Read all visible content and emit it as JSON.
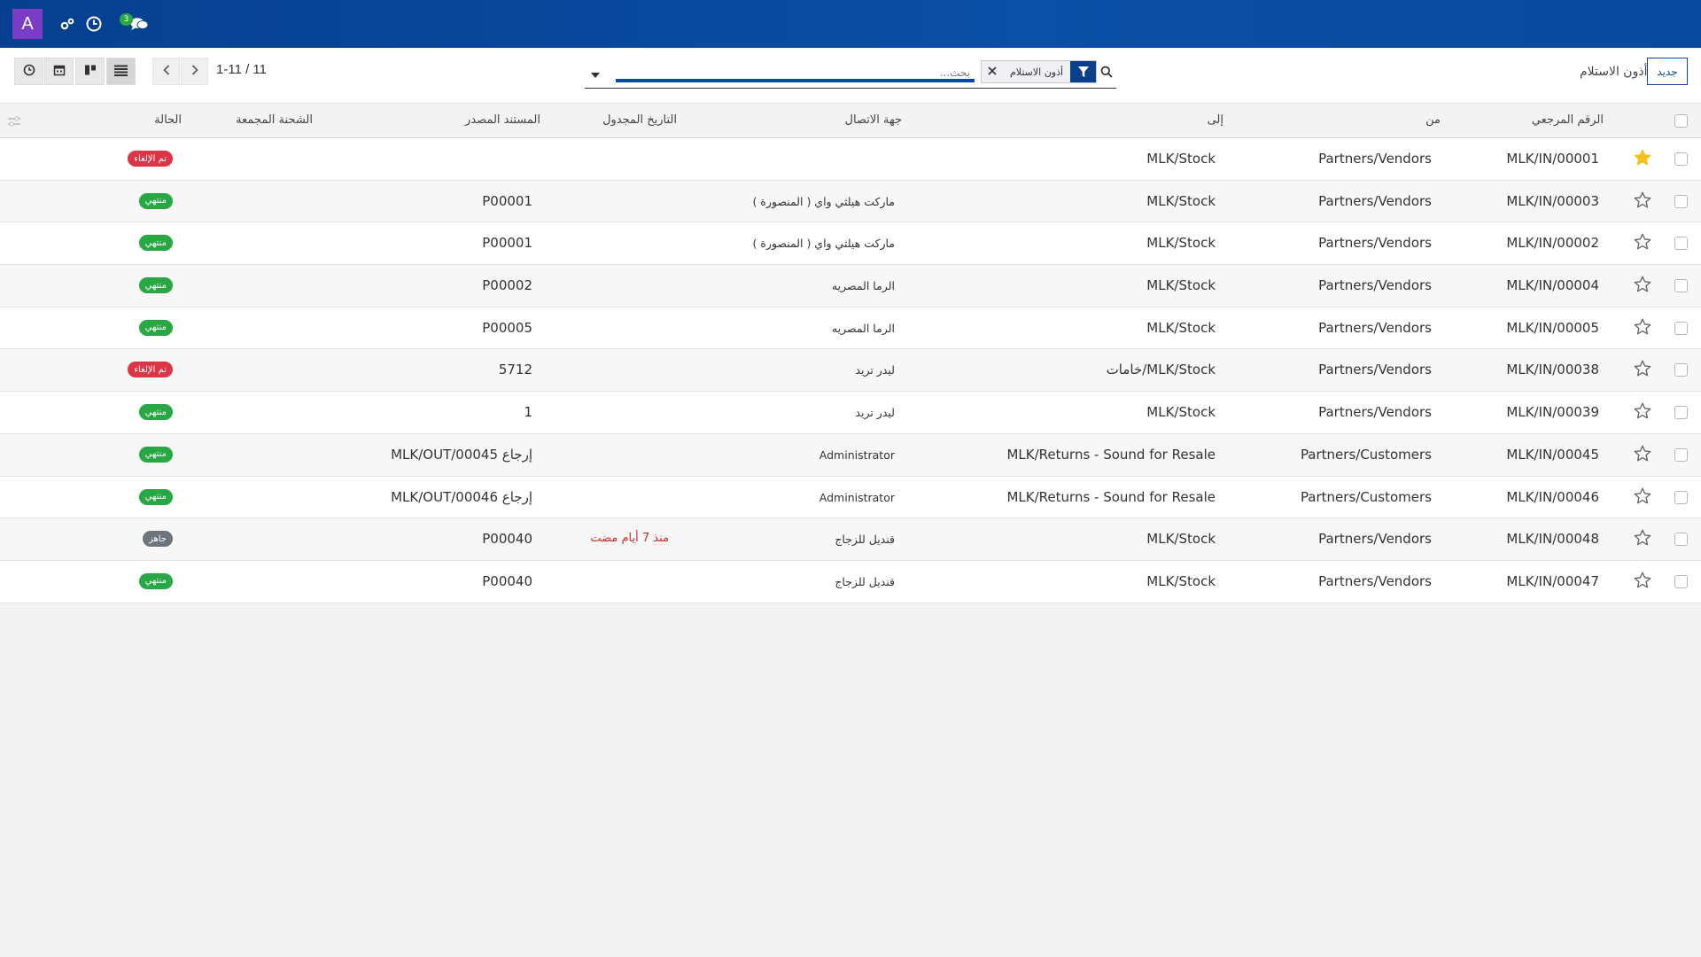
{
  "navbar": {
    "avatar_letter": "A",
    "icons": [
      "cogs-icon",
      "clock-icon",
      "chat-icon"
    ],
    "messages_count": "3"
  },
  "control": {
    "pager": "1-11 / 11",
    "search_placeholder": "بحث...",
    "facet_label": "أذون الاستلام",
    "breadcrumb": "أذون الاستلام",
    "new_button": "جديد",
    "views": [
      "list-icon",
      "kanban-icon",
      "calendar-icon",
      "activity-icon"
    ]
  },
  "table": {
    "headers": {
      "reference": "الرقم المرجعي",
      "from": "من",
      "to": "إلى",
      "contact": "جهة الاتصال",
      "scheduled": "التاريخ المجدول",
      "source": "المستند المصدر",
      "batch": "الشحنة المجمعة",
      "status": "الحالة"
    },
    "rows": [
      {
        "ref": "MLK/IN/00001",
        "from": "Partners/Vendors",
        "to": "MLK/Stock",
        "contact": "",
        "scheduled": "",
        "source": "",
        "status": "تم الإلغاء",
        "status_type": "cancel",
        "starred": true
      },
      {
        "ref": "MLK/IN/00003",
        "from": "Partners/Vendors",
        "to": "MLK/Stock",
        "contact": "ماركت هيلثي واي ( المنصورة )",
        "scheduled": "",
        "source": "P00001",
        "status": "منتهي",
        "status_type": "done",
        "starred": false
      },
      {
        "ref": "MLK/IN/00002",
        "from": "Partners/Vendors",
        "to": "MLK/Stock",
        "contact": "ماركت هيلثي واي ( المنصورة )",
        "scheduled": "",
        "source": "P00001",
        "status": "منتهي",
        "status_type": "done",
        "starred": false
      },
      {
        "ref": "MLK/IN/00004",
        "from": "Partners/Vendors",
        "to": "MLK/Stock",
        "contact": "الرما المصريه",
        "scheduled": "",
        "source": "P00002",
        "status": "منتهي",
        "status_type": "done",
        "starred": false
      },
      {
        "ref": "MLK/IN/00005",
        "from": "Partners/Vendors",
        "to": "MLK/Stock",
        "contact": "الرما المصريه",
        "scheduled": "",
        "source": "P00005",
        "status": "منتهي",
        "status_type": "done",
        "starred": false
      },
      {
        "ref": "MLK/IN/00038",
        "from": "Partners/Vendors",
        "to": "MLK/Stock/خامات",
        "contact": "ليدر تريد",
        "scheduled": "",
        "source": "5712",
        "status": "تم الإلغاء",
        "status_type": "cancel",
        "starred": false
      },
      {
        "ref": "MLK/IN/00039",
        "from": "Partners/Vendors",
        "to": "MLK/Stock",
        "contact": "ليدر تريد",
        "scheduled": "",
        "source": "1",
        "status": "منتهي",
        "status_type": "done",
        "starred": false
      },
      {
        "ref": "MLK/IN/00045",
        "from": "Partners/Customers",
        "to": "MLK/Returns - Sound for Resale",
        "contact": "Administrator",
        "scheduled": "",
        "source": "إرجاع MLK/OUT/00045",
        "status": "منتهي",
        "status_type": "done",
        "starred": false
      },
      {
        "ref": "MLK/IN/00046",
        "from": "Partners/Customers",
        "to": "MLK/Returns - Sound for Resale",
        "contact": "Administrator",
        "scheduled": "",
        "source": "إرجاع MLK/OUT/00046",
        "status": "منتهي",
        "status_type": "done",
        "starred": false
      },
      {
        "ref": "MLK/IN/00048",
        "from": "Partners/Vendors",
        "to": "MLK/Stock",
        "contact": "قنديل للزجاج",
        "scheduled": "منذ 7 أيام مضت",
        "source": "P00040",
        "status": "جاهز",
        "status_type": "ready",
        "starred": false
      },
      {
        "ref": "MLK/IN/00047",
        "from": "Partners/Vendors",
        "to": "MLK/Stock",
        "contact": "قنديل للزجاج",
        "scheduled": "",
        "source": "P00040",
        "status": "منتهي",
        "status_type": "done",
        "starred": false
      }
    ]
  },
  "colors": {
    "navbar": "#0a4a9e",
    "avatar": "#7b3cc6",
    "done": "#28a745",
    "cancel": "#dc3545",
    "ready": "#6c757d",
    "star": "#f3c31b",
    "late": "#d62828"
  }
}
